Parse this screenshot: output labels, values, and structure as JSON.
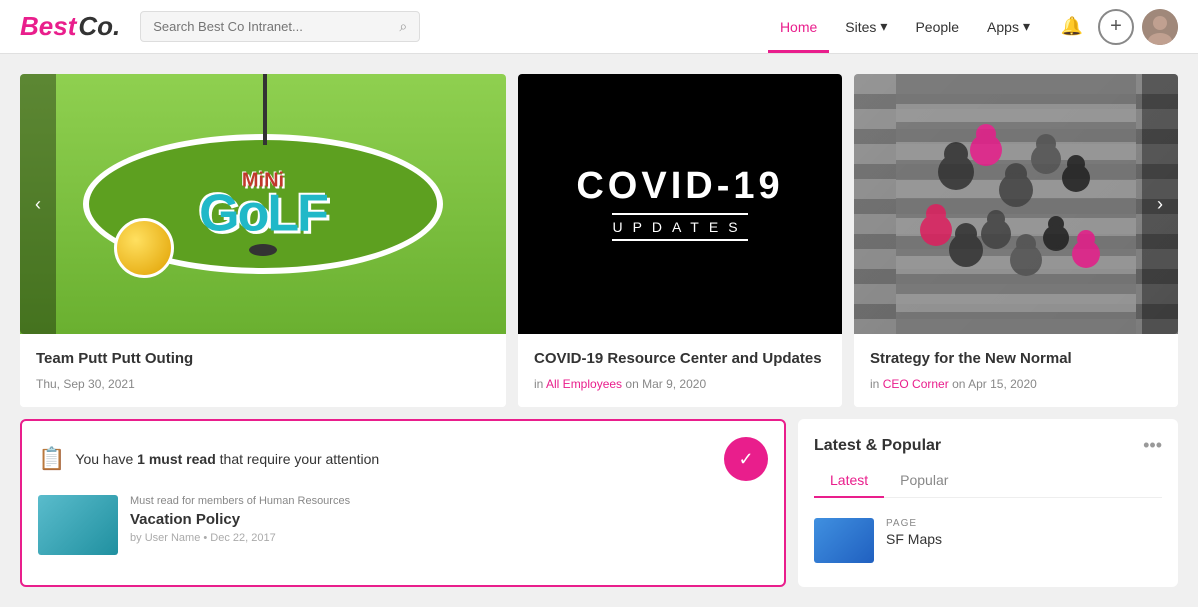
{
  "header": {
    "logo_best": "Best",
    "logo_co": "Co.",
    "search_placeholder": "Search Best Co Intranet...",
    "nav": [
      {
        "id": "home",
        "label": "Home",
        "active": true
      },
      {
        "id": "sites",
        "label": "Sites",
        "has_dropdown": true
      },
      {
        "id": "people",
        "label": "People",
        "has_dropdown": false
      },
      {
        "id": "apps",
        "label": "Apps",
        "has_dropdown": true
      }
    ],
    "notification_icon": "🔔",
    "add_icon": "+",
    "avatar_alt": "User avatar"
  },
  "carousel": {
    "prev_label": "‹",
    "next_label": "›",
    "items": [
      {
        "id": "mini-golf",
        "type": "event",
        "title": "Team Putt Putt Outing",
        "date": "Thu, Sep 30, 2021",
        "category": "",
        "category_color": ""
      },
      {
        "id": "covid",
        "type": "resource",
        "title": "COVID-19 Resource Center and Updates",
        "date": "Mar 9, 2020",
        "prefix": "in",
        "category": "All Employees",
        "category_color": "#e91e8c",
        "covid_title": "COVID-19",
        "covid_updates": "UPDATES"
      },
      {
        "id": "crosswalk",
        "type": "article",
        "title": "Strategy for the New Normal",
        "date": "Apr 15, 2020",
        "prefix": "in",
        "category": "CEO Corner",
        "category_color": "#e91e8c"
      }
    ]
  },
  "must_read": {
    "header_text": "You have ",
    "count": "1 must read",
    "suffix": " that require your attention",
    "item": {
      "tag": "Must read for members of Human Resources",
      "title": "Vacation Policy",
      "meta_prefix": "by",
      "author": "User Name",
      "date": "Dec 22, 2017"
    }
  },
  "latest_popular": {
    "title": "Latest & Popular",
    "tabs": [
      {
        "id": "latest",
        "label": "Latest",
        "active": true
      },
      {
        "id": "popular",
        "label": "Popular",
        "active": false
      }
    ],
    "items": [
      {
        "type_label": "PAGE",
        "name": "SF Maps",
        "thumb_color": "#4090e0"
      }
    ],
    "more_icon": "•••"
  }
}
